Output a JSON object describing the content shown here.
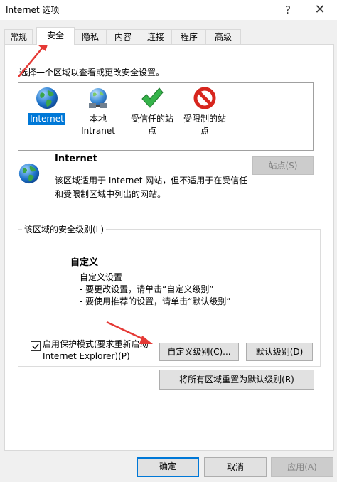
{
  "window": {
    "title": "Internet 选项",
    "help_icon": "?",
    "close_icon": "✕"
  },
  "tabs": [
    {
      "label": "常规"
    },
    {
      "label": "安全",
      "active": true
    },
    {
      "label": "隐私"
    },
    {
      "label": "内容"
    },
    {
      "label": "连接"
    },
    {
      "label": "程序"
    },
    {
      "label": "高级"
    }
  ],
  "security": {
    "instruction": "选择一个区域以查看或更改安全设置。",
    "zones": [
      {
        "line1": "Internet",
        "line2": "",
        "icon": "globe-icon",
        "selected": true
      },
      {
        "line1": "本地",
        "line2": "Intranet",
        "icon": "intranet-globe-icon"
      },
      {
        "line1": "受信任的站",
        "line2": "点",
        "icon": "checkmark-icon"
      },
      {
        "line1": "受限制的站",
        "line2": "点",
        "icon": "restricted-icon"
      }
    ],
    "zone_info": {
      "title": "Internet",
      "desc_line1": "该区域适用于 Internet 网站，但不适用于在受信任",
      "desc_line2": "和受限制区域中列出的网站。",
      "sites_button": "站点(S)"
    },
    "level_group": {
      "label": "该区域的安全级别(L)",
      "level_title": "自定义",
      "lines": [
        "自定义设置",
        "- 要更改设置，请单击“自定义级别”",
        "- 要使用推荐的设置，请单击“默认级别”"
      ]
    },
    "protected_mode": {
      "checked": true,
      "label_line1": "启用保护模式(要求重新启动",
      "label_line2": "Internet Explorer)(P)"
    },
    "buttons": {
      "custom_level": "自定义级别(C)...",
      "default_level": "默认级别(D)",
      "reset_all": "将所有区域重置为默认级别(R)"
    }
  },
  "footer": {
    "ok": "确定",
    "cancel": "取消",
    "apply": "应用(A)"
  },
  "colors": {
    "selection": "#0078d7",
    "arrow": "#e53935",
    "panel": "#ffffff",
    "window": "#f0f0f0"
  }
}
